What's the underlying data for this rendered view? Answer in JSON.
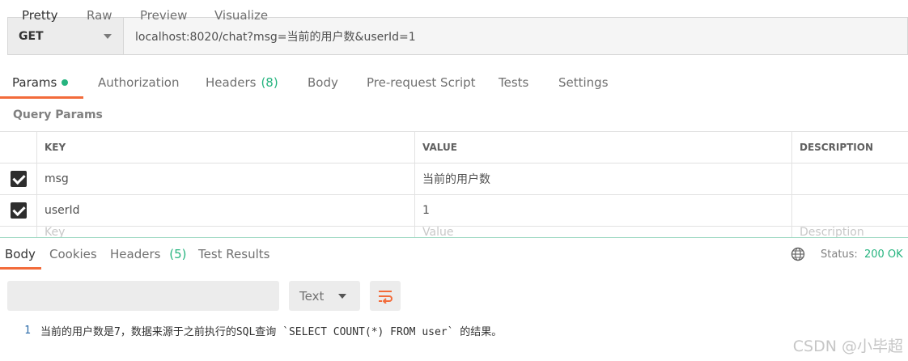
{
  "request": {
    "method": "GET",
    "url": "localhost:8020/chat?msg=当前的用户数&userId=1"
  },
  "request_tabs": [
    {
      "label": "Params",
      "active": true
    },
    {
      "label": "Authorization"
    },
    {
      "label": "Headers",
      "count": "(8)"
    },
    {
      "label": "Body"
    },
    {
      "label": "Pre-request Script"
    },
    {
      "label": "Tests"
    },
    {
      "label": "Settings"
    }
  ],
  "query_params": {
    "title": "Query Params",
    "columns": {
      "key": "KEY",
      "value": "VALUE",
      "description": "DESCRIPTION"
    },
    "rows": [
      {
        "checked": true,
        "key": "msg",
        "value": "当前的用户数",
        "description": ""
      },
      {
        "checked": true,
        "key": "userId",
        "value": "1",
        "description": ""
      }
    ],
    "placeholders": {
      "key": "Key",
      "value": "Value",
      "description": "Description"
    }
  },
  "response_tabs": [
    {
      "label": "Body",
      "active": true
    },
    {
      "label": "Cookies"
    },
    {
      "label": "Headers",
      "count": "(5)"
    },
    {
      "label": "Test Results"
    }
  ],
  "response_status": {
    "label": "Status:",
    "value": "200 OK"
  },
  "view_modes": [
    "Pretty",
    "Raw",
    "Preview",
    "Visualize"
  ],
  "selected_view": "Pretty",
  "format": "Text",
  "response_body": {
    "line_number": "1",
    "text": "当前的用户数是7，数据来源于之前执行的SQL查询 `SELECT COUNT(*) FROM user` 的结果。"
  },
  "watermark": "CSDN @小毕超",
  "colors": {
    "accent": "#f26b3a",
    "success": "#26b47f"
  }
}
